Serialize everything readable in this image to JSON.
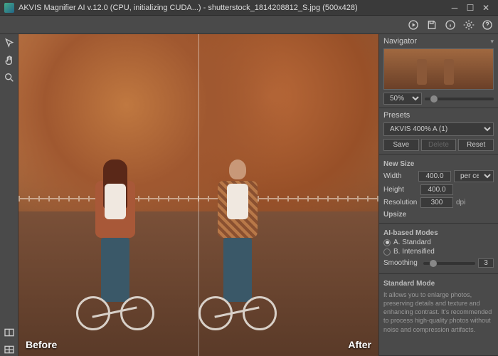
{
  "title": "AKVIS Magnifier AI v.12.0 (CPU, initializing CUDA...) - shutterstock_1814208812_S.jpg (500x428)",
  "canvas": {
    "before": "Before",
    "after": "After"
  },
  "navigator": {
    "header": "Navigator",
    "zoom": "50%"
  },
  "presets": {
    "header": "Presets",
    "selected": "AKVIS 400% A (1)",
    "save": "Save",
    "delete": "Delete",
    "reset": "Reset"
  },
  "newsize": {
    "header": "New Size",
    "width_label": "Width",
    "width": "400.0",
    "height_label": "Height",
    "height": "400.0",
    "unit": "per cent",
    "res_label": "Resolution",
    "res": "300",
    "res_unit": "dpi",
    "upsize": "Upsize"
  },
  "aimodes": {
    "header": "AI-based Modes",
    "a": "A. Standard",
    "b": "B. Intensified"
  },
  "smoothing": {
    "label": "Smoothing",
    "value": "3"
  },
  "stdmode": {
    "header": "Standard Mode",
    "desc": "It allows you to enlarge photos, preserving details and texture and enhancing contrast. It's recommended to process high-quality photos without noise and compression artifacts."
  }
}
